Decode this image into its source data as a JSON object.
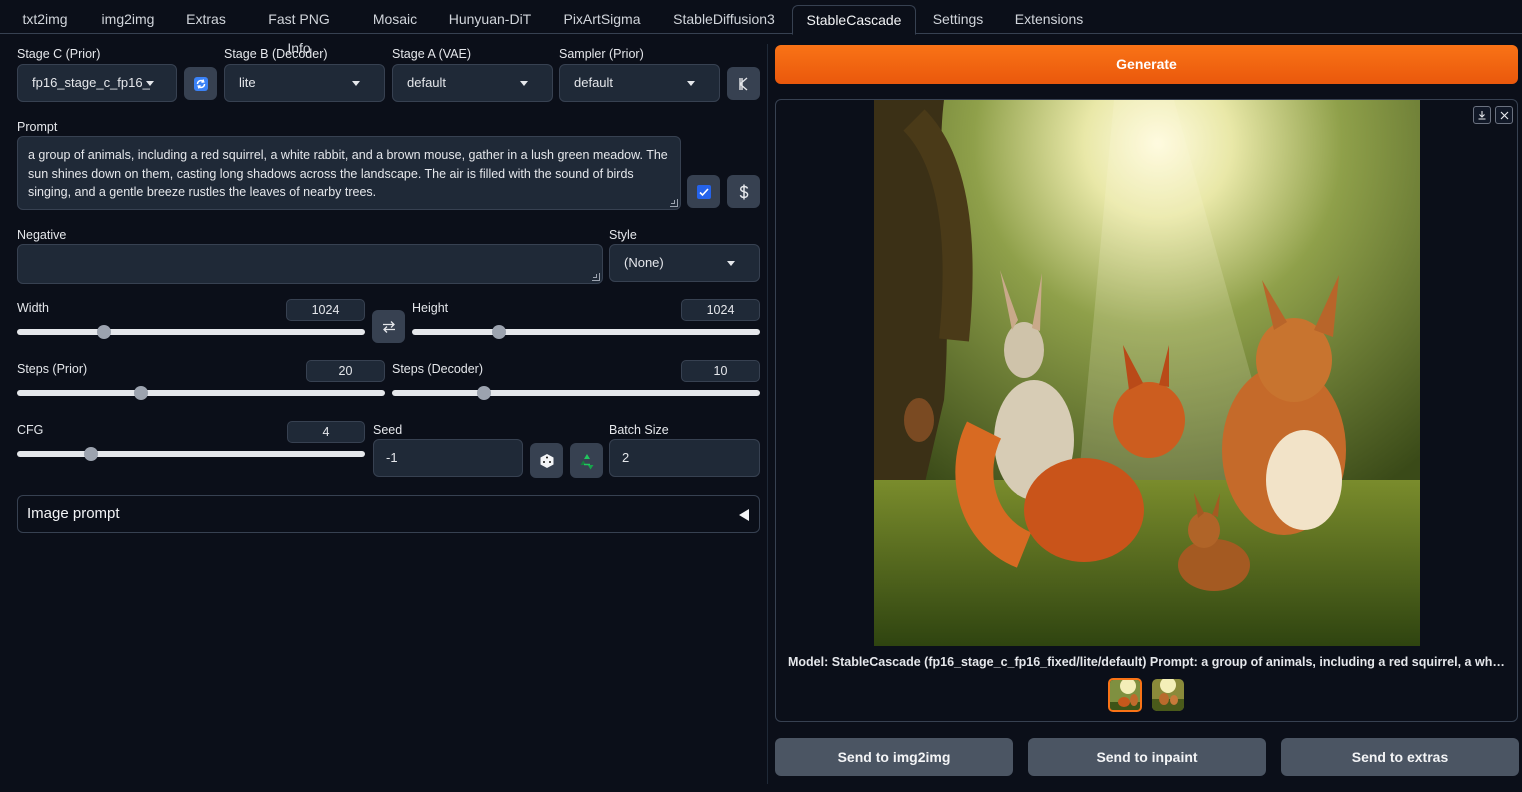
{
  "tabs": [
    "txt2img",
    "img2img",
    "Extras",
    "Fast PNG Info",
    "Mosaic",
    "Hunyuan-DiT",
    "PixArtSigma",
    "StableDiffusion3",
    "StableCascade",
    "Settings",
    "Extensions"
  ],
  "active_tab": "StableCascade",
  "stage_c": {
    "label": "Stage C (Prior)",
    "value": "fp16_stage_c_fp16_"
  },
  "stage_b": {
    "label": "Stage B (Decoder)",
    "value": "lite"
  },
  "stage_a": {
    "label": "Stage A (VAE)",
    "value": "default"
  },
  "sampler": {
    "label": "Sampler (Prior)",
    "value": "default"
  },
  "prompt": {
    "label": "Prompt",
    "value": "a group of animals, including a red squirrel, a white rabbit, and a brown mouse, gather in a lush green meadow. The sun shines down on them, casting long shadows across the landscape. The air is filled with the sound of birds singing, and a gentle breeze rustles the leaves of nearby trees."
  },
  "negative": {
    "label": "Negative",
    "value": ""
  },
  "style": {
    "label": "Style",
    "value": "(None)"
  },
  "width": {
    "label": "Width",
    "value": "1024",
    "fraction": 0.24
  },
  "height": {
    "label": "Height",
    "value": "1024",
    "fraction": 0.24
  },
  "steps_prior": {
    "label": "Steps (Prior)",
    "value": "20",
    "fraction": 0.33
  },
  "steps_decoder": {
    "label": "Steps (Decoder)",
    "value": "10",
    "fraction": 0.24
  },
  "cfg": {
    "label": "CFG",
    "value": "4",
    "fraction": 0.2
  },
  "seed": {
    "label": "Seed",
    "value": "-1"
  },
  "batch": {
    "label": "Batch Size",
    "value": "2"
  },
  "image_prompt": {
    "label": "Image prompt"
  },
  "generate_label": "Generate",
  "caption": "Model: StableCascade (fp16_stage_c_fp16_fixed/lite/default) Prompt: a group of animals, including a red squirrel, a white rabbit, and a brown mouse, gather in a lush green meadow.",
  "send_buttons": [
    "Send to img2img",
    "Send to inpaint",
    "Send to extras"
  ],
  "icons": {
    "refresh": "refresh-icon",
    "k": "k-icon",
    "checkbox": "checkbox-icon",
    "dollar": "dollar-icon",
    "swap": "swap-icon",
    "dice": "dice-icon",
    "recycle": "recycle-icon",
    "download": "download-icon",
    "close": "close-icon"
  },
  "colors": {
    "accent": "#f97316",
    "background": "#0b0f19",
    "panel": "#1f2937"
  }
}
